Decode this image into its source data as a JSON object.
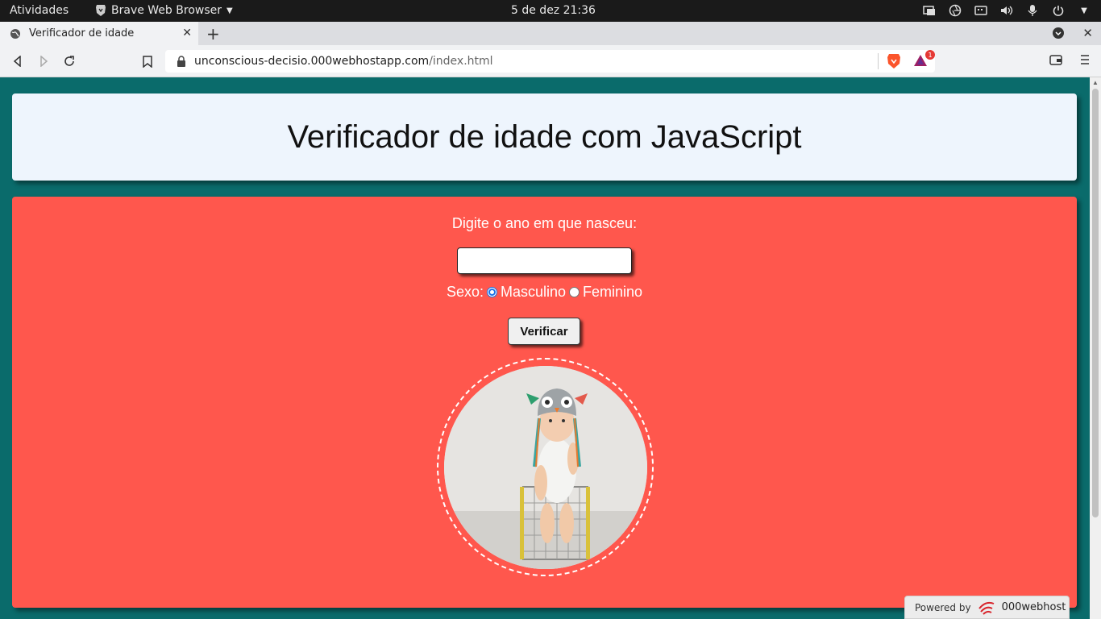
{
  "topbar": {
    "activities": "Atividades",
    "app_name": "Brave Web Browser",
    "clock": "5 de dez  21:36"
  },
  "tab": {
    "title": "Verificador de idade"
  },
  "toolbar": {
    "url_host": "unconscious-decisio.000webhostapp.com",
    "url_path": "/index.html",
    "rewards_badge": "1"
  },
  "page": {
    "heading": "Verificador de idade com JavaScript",
    "prompt": "Digite o ano em que nasceu:",
    "year_value": "",
    "sex_label": "Sexo:",
    "sex_options": [
      "Masculino",
      "Feminino"
    ],
    "sex_selected": "Masculino",
    "verify_label": "Verificar"
  },
  "footer": {
    "powered_by": "Powered by",
    "brand": "000webhost"
  },
  "colors": {
    "page_bg": "#0a6b6b",
    "header_bg": "#eef5fd",
    "main_bg": "#ff574d"
  }
}
